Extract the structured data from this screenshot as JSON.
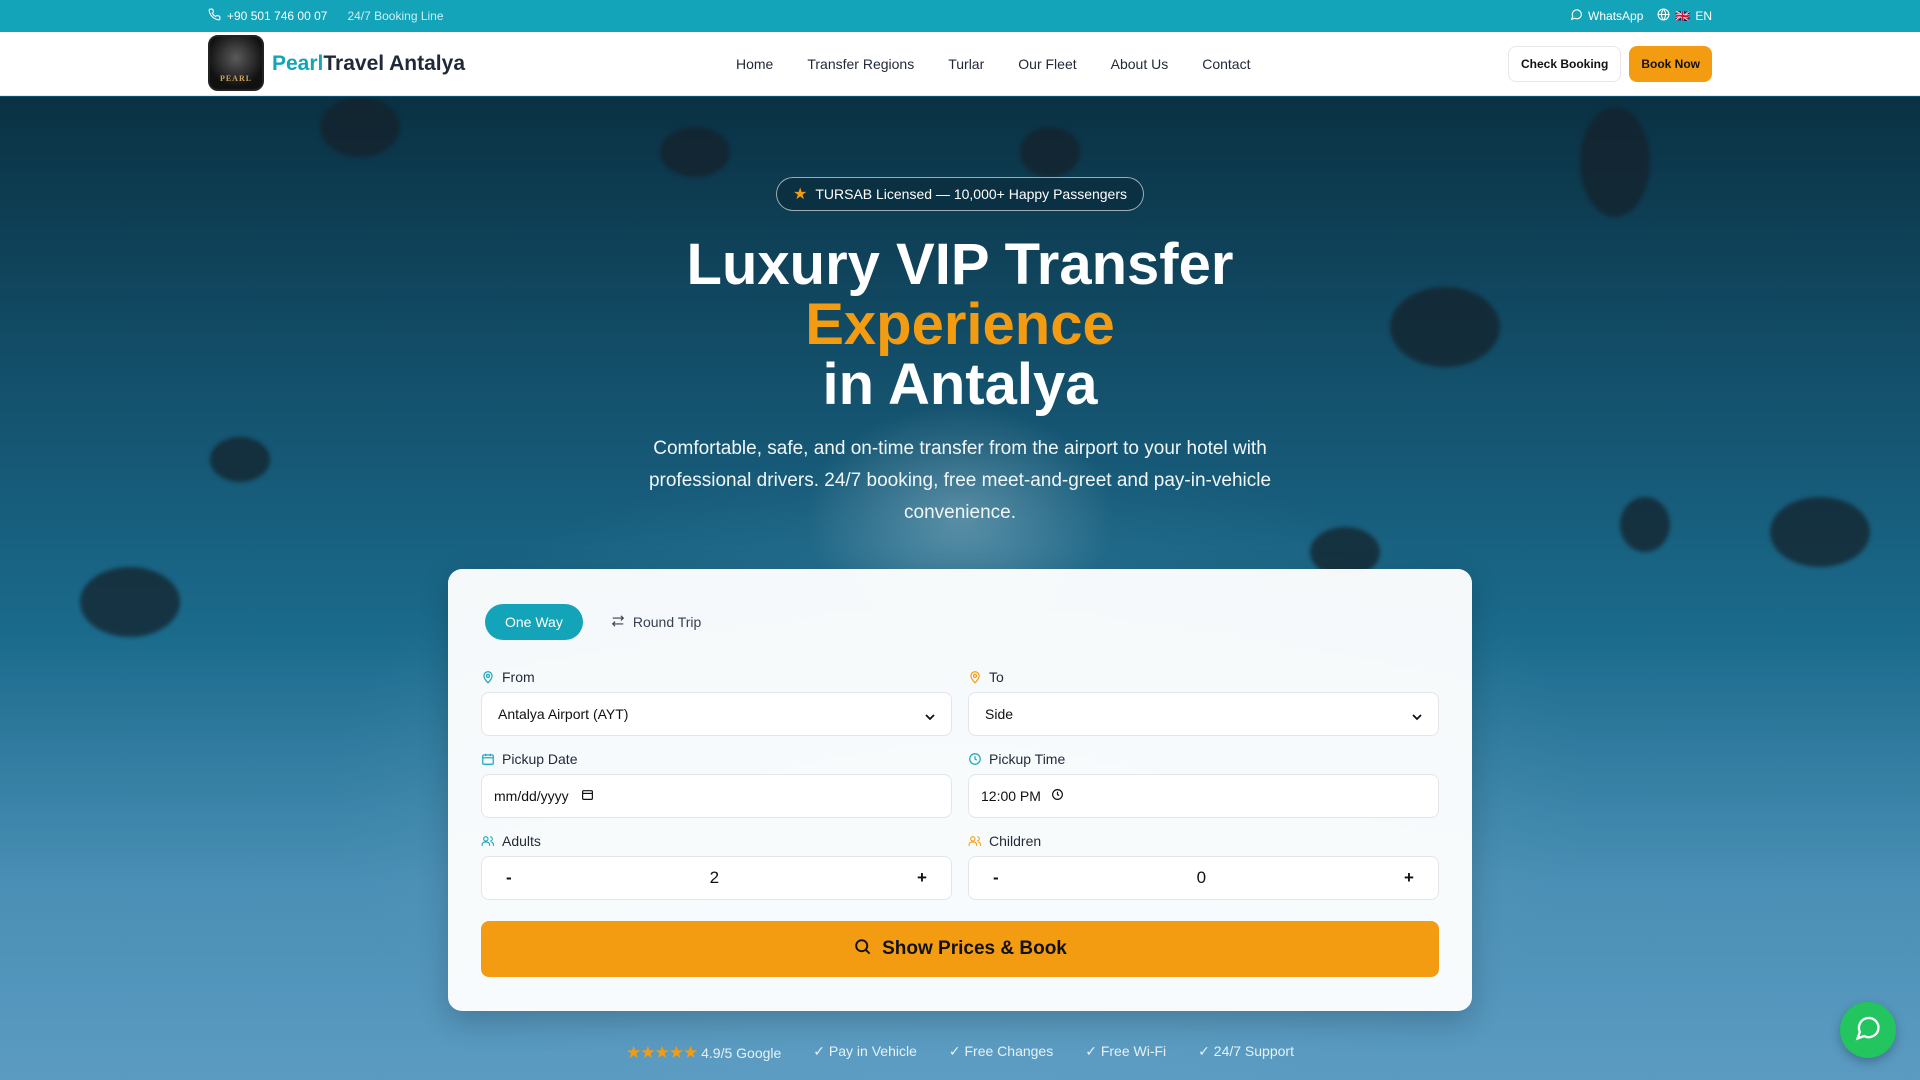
{
  "topbar": {
    "phone": "+90 501 746 00 07",
    "booking_line": "24/7 Booking Line",
    "whatsapp": "WhatsApp",
    "language_flag": "🇬🇧",
    "language": "EN"
  },
  "header": {
    "logo_text": "PEARL",
    "brand_part1": "Pearl",
    "brand_part2": "Travel Antalya",
    "nav": [
      "Home",
      "Transfer Regions",
      "Turlar",
      "Our Fleet",
      "About Us",
      "Contact"
    ],
    "check_booking": "Check Booking",
    "book_now": "Book Now"
  },
  "hero": {
    "badge": "TURSAB Licensed — 10,000+ Happy Passengers",
    "title_line1": "Luxury VIP Transfer",
    "title_accent": "Experience",
    "title_line3": "in Antalya",
    "subtitle": "Comfortable, safe, and on-time transfer from the airport to your hotel with professional drivers. 24/7 booking, free meet-and-greet and pay-in-vehicle convenience."
  },
  "booking": {
    "tab_one_way": "One Way",
    "tab_round_trip": "Round Trip",
    "from_label": "From",
    "from_value": "Antalya Airport (AYT)",
    "to_label": "To",
    "to_value": "Side",
    "date_label": "Pickup Date",
    "date_value": "mm/dd/yyyy",
    "time_label": "Pickup Time",
    "time_value": "12:00 PM",
    "adults_label": "Adults",
    "adults_value": "2",
    "children_label": "Children",
    "children_value": "0",
    "minus": "-",
    "plus": "+",
    "submit": "Show Prices & Book"
  },
  "trust": {
    "stars": "★★★★★",
    "rating": "4.9/5 Google",
    "items": [
      "✓ Pay in Vehicle",
      "✓ Free Changes",
      "✓ Free Wi-Fi",
      "✓ 24/7 Support"
    ]
  },
  "colors": {
    "teal": "#13a4b9",
    "orange": "#f39c12",
    "whatsapp_green": "#22c55e"
  }
}
